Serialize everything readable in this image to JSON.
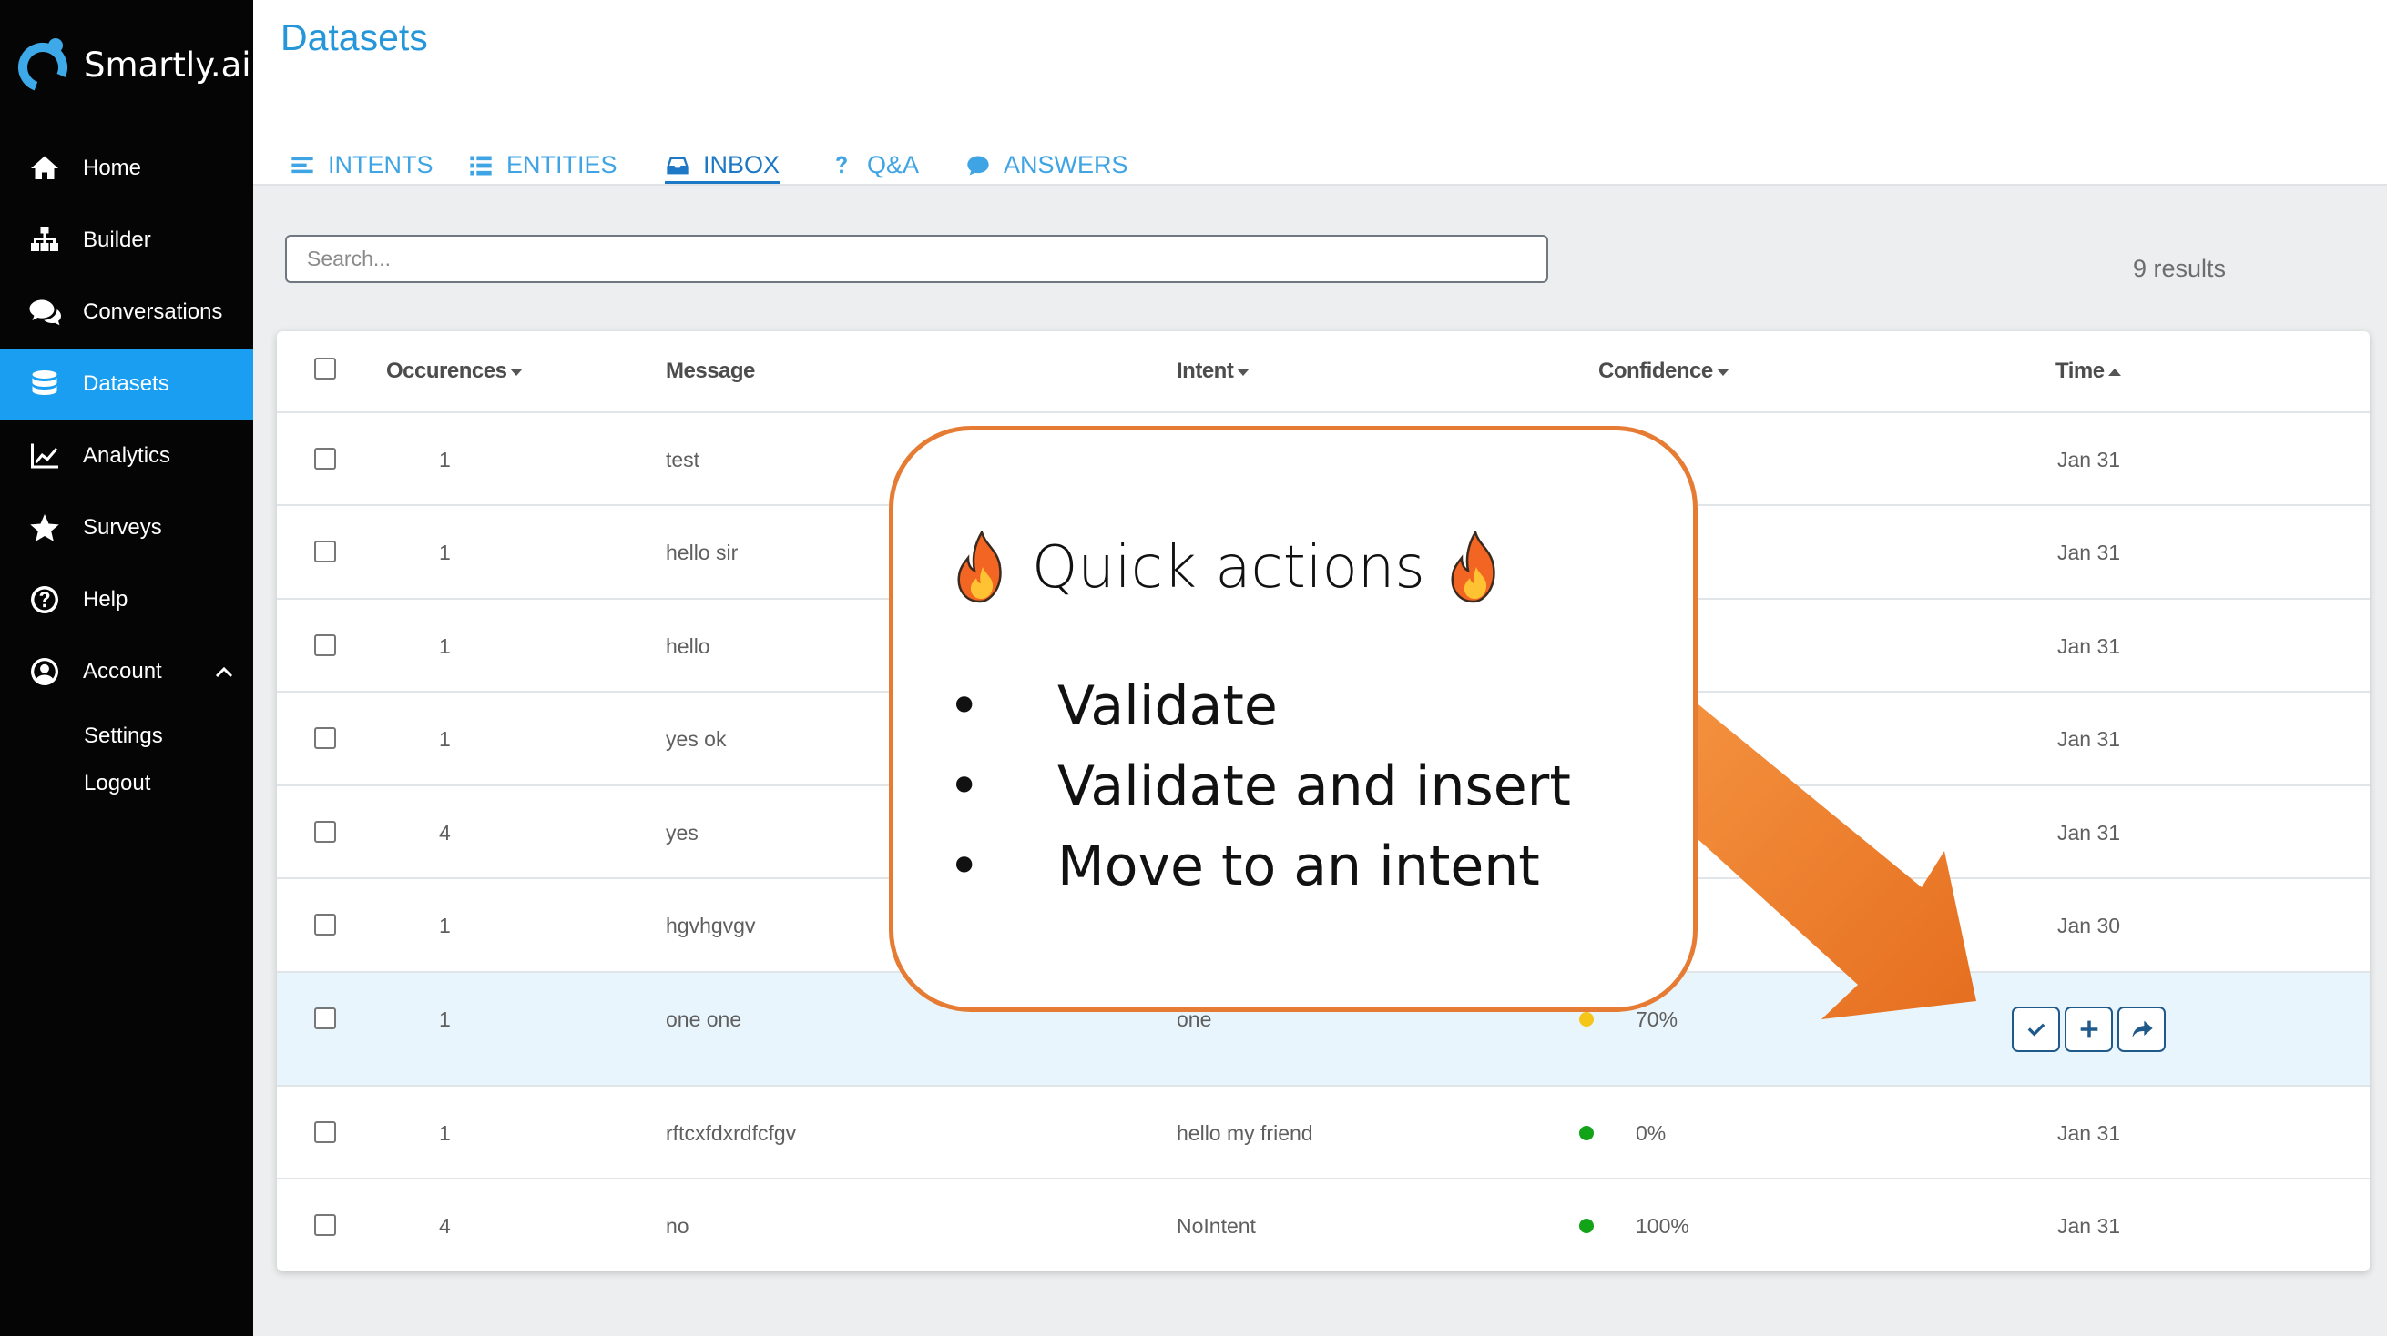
{
  "app": {
    "name": "Smartly.ai"
  },
  "sidebar": {
    "items": [
      {
        "label": "Home",
        "icon": "home-icon"
      },
      {
        "label": "Builder",
        "icon": "sitemap-icon"
      },
      {
        "label": "Conversations",
        "icon": "comments-icon"
      },
      {
        "label": "Datasets",
        "icon": "database-icon",
        "active": true
      },
      {
        "label": "Analytics",
        "icon": "line-chart-icon"
      },
      {
        "label": "Surveys",
        "icon": "star-icon"
      },
      {
        "label": "Help",
        "icon": "question-circle-icon"
      },
      {
        "label": "Account",
        "icon": "user-circle-icon"
      }
    ],
    "account_sub": [
      "Settings",
      "Logout"
    ]
  },
  "header": {
    "title": "Datasets",
    "tabs": [
      {
        "label": "INTENTS",
        "icon": "align-left-icon"
      },
      {
        "label": "ENTITIES",
        "icon": "list-icon"
      },
      {
        "label": "INBOX",
        "icon": "inbox-icon",
        "active": true
      },
      {
        "label": "Q&A",
        "icon": "question-icon"
      },
      {
        "label": "ANSWERS",
        "icon": "comment-icon"
      }
    ]
  },
  "search": {
    "placeholder": "Search...",
    "value": ""
  },
  "results_label": "9 results",
  "table": {
    "columns": [
      "Occurences",
      "Message",
      "Intent",
      "Confidence",
      "Time"
    ],
    "rows": [
      {
        "occ": "1",
        "message": "test",
        "intent": "",
        "confidence": "",
        "time": "Jan 31"
      },
      {
        "occ": "1",
        "message": "hello sir",
        "intent": "",
        "confidence": "",
        "time": "Jan 31"
      },
      {
        "occ": "1",
        "message": "hello",
        "intent": "",
        "confidence": "",
        "time": "Jan 31"
      },
      {
        "occ": "1",
        "message": "yes ok",
        "intent": "",
        "confidence": "",
        "time": "Jan 31"
      },
      {
        "occ": "4",
        "message": "yes",
        "intent": "",
        "confidence": "",
        "time": "Jan 31"
      },
      {
        "occ": "1",
        "message": "hgvhgvgv",
        "intent": "",
        "confidence": "",
        "time": "Jan 30"
      },
      {
        "occ": "1",
        "message": "one one",
        "intent": "one",
        "confidence": "70%",
        "time": "",
        "dot_color": "#f5c518"
      },
      {
        "occ": "1",
        "message": "rftcxfdxrdfcfgv",
        "intent": "hello my friend",
        "confidence": "0%",
        "time": "Jan 31",
        "dot_color": "#12a319"
      },
      {
        "occ": "4",
        "message": "no",
        "intent": "NoIntent",
        "confidence": "100%",
        "time": "Jan 31",
        "dot_color": "#12a319"
      }
    ],
    "row_actions": [
      "check-icon",
      "plus-icon",
      "share-icon"
    ]
  },
  "callout": {
    "title": "Quick actions",
    "bullets": [
      "Validate",
      "Validate and insert",
      "Move to an intent"
    ],
    "bullet_char": "•",
    "border_color": "#e67b33"
  },
  "colors": {
    "accent": "#1a9ef2",
    "sidebar_bg": "#050505",
    "title": "#2596d9"
  }
}
